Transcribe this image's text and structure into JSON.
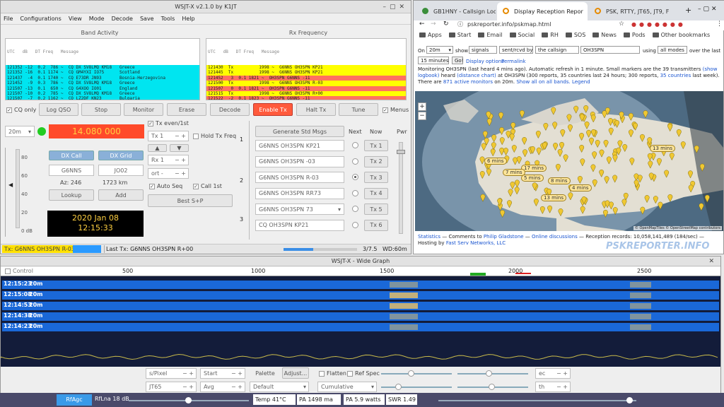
{
  "wsjt": {
    "title": "WSJT-X   v2.1.0   by K1JT",
    "menus": [
      "File",
      "Configurations",
      "View",
      "Mode",
      "Decode",
      "Save",
      "Tools",
      "Help"
    ],
    "band_activity_title": "Band Activity",
    "rx_freq_title": "Rx Frequency",
    "col_headers": "UTC   dB   DT Freq   Message",
    "band_rows": [
      "121352 -12  0.2  786 ~  CQ DX SV8LMQ KM18   Greece",
      "121352 -16  0.1 1174 ~  CQ GM4YXI IO75      Scotland",
      "121437  -4  0.1 1740 ~  CQ E73DR JN93       Bosnia-Herzegovina",
      "121452  -9  0.3  786 ~  CQ DX SV8LMQ KM18   Greece",
      "121507 -13  0.1  650 ~  CQ G4XOO IO01       England",
      "121507 -10  0.2  785 ~  CQ DX SV8LMQ KM18   Greece",
      "121507  -7  0.2 1162 ~  CQ LZ2DF KN23       Bulgaria",
      "121522  -2  0.2 1162 ~  CQ LZ2DF KN23       Bulgaria"
    ],
    "rx_rows": [
      {
        "t": "121430  Tx          1998 ~  G6NNS OH3SPN KP21",
        "c": "ye"
      },
      {
        "t": "121445  Tx          1998 ~  G6NNS OH3SPN KP21",
        "c": "ye"
      },
      {
        "t": "121452   3  0.1 1821 ~  OH3SPN G6NNS -11",
        "c": "rd"
      },
      {
        "t": "121500  Tx          1998 ~  G6NNS OH3SPN R-03",
        "c": "ye"
      },
      {
        "t": "121507   0  0.1 1821 ~  OH3SPN G6NNS -11",
        "c": "rd"
      },
      {
        "t": "121515  Tx          1998 ~  G6NNS OH3SPN R+00",
        "c": "ye"
      },
      {
        "t": "121522  -2  0.1 1823 ~  OH3SPN G6NNS -11",
        "c": "rd"
      },
      {
        "t": "121530  Tx          1998 ~  G6NNS OH3SPN R+03",
        "c": "ye"
      }
    ],
    "cq_only": "CQ only",
    "buttons": {
      "log_qso": "Log QSO",
      "stop": "Stop",
      "monitor": "Monitor",
      "erase": "Erase",
      "decode": "Decode",
      "enable_tx": "Enable Tx",
      "halt_tx": "Halt Tx",
      "tune": "Tune",
      "menus": "Menus"
    },
    "band": "20m",
    "frequency": "14.080 000",
    "tx_even": "Tx even/1st",
    "hold_tx": "Hold Tx Freq",
    "tx_field": "Tx 1",
    "rx_field": "Rx 1",
    "report_field": "ort -",
    "auto_seq": "Auto Seq",
    "call_1st": "Call 1st",
    "best_sp": "Best S+P",
    "dx_call_label": "DX Call",
    "dx_grid_label": "DX Grid",
    "dx_call": "G6NNS",
    "dx_grid": "JO02",
    "az": "Az: 246",
    "dist": "1723 km",
    "lookup": "Lookup",
    "add": "Add",
    "date": "2020 Jan 08",
    "time": "12:15:33",
    "db_ticks": [
      "80",
      "60",
      "40",
      "20",
      "0 dB"
    ],
    "gen_msgs": "Generate Std Msgs",
    "next": "Next",
    "now": "Now",
    "pwr": "Pwr",
    "tabs": [
      "1",
      "2",
      "3"
    ],
    "msgs": [
      "G6NNS OH3SPN KP21",
      "G6NNS OH3SPN -03",
      "G6NNS OH3SPN R-03",
      "G6NNS OH3SPN RR73",
      "G6NNS OH3SPN 73",
      "CQ OH3SPN KP21"
    ],
    "tx_btns": [
      "Tx 1",
      "Tx 2",
      "Tx 3",
      "Tx 4",
      "Tx 5",
      "Tx 6"
    ],
    "status_tx": "Tx: G6NNS OH3SPN R-03",
    "status_last": "Last Tx: G6NNS OH3SPN R+00",
    "status_prog": "3/7.5",
    "status_wd": "WD:60m"
  },
  "browser": {
    "tabs": [
      "GB1HNY - Callsign Look",
      "Display Reception Repor",
      "PSK, RTTY, JT65, JT9, F"
    ],
    "url": "pskreporter.info/pskmap.html",
    "bookmarks": [
      "Apps",
      "Start",
      "Email",
      "Social",
      "RH",
      "SOS",
      "News",
      "Pods",
      "Other bookmarks"
    ],
    "on": "On",
    "band": "20m",
    "show": "show",
    "signals": "signals",
    "sent": "sent/rcvd by",
    "callsign_sel": "the callsign",
    "callsign": "OH3SPN",
    "using": "using",
    "modes": "all modes",
    "over": "over the last",
    "period": "15 minutes",
    "go": "Go!",
    "display_opts": "Display options",
    "permalink": "Permalink",
    "monitoring": "Monitoring OH3SPN (last heard 4 mins ago). Automatic refresh in 1 minute. Small markers are the 39 transmitters",
    "show_logbook": "(show logbook)",
    "heard": "heard",
    "distance_chart": "(distance chart)",
    "at_line": "at OH3SPN (300 reports, 35 countries last 24 hours; 300 reports,",
    "countries_link": "35 countries",
    "last_week": "last week).",
    "there_are": "There are",
    "active": "871 active monitors",
    "on20": "on 20m.",
    "show_all": "Show all on all bands.",
    "legend": "Legend",
    "map_labels": [
      "6 mins",
      "13 mins",
      "17 mins",
      "5 mins",
      "13 mins",
      "4 mins",
      "8 mins",
      "7 mins"
    ],
    "map_credit": "© OpenMapTiles © OpenStreetMap contributors",
    "footer_stats": "Statistics",
    "footer_comments": "— Comments to",
    "footer_name": "Philip Gladstone",
    "footer_online": "Online discussions",
    "footer_records": "— Reception records: 10,058,141,489 (184/sec) — Hosting by",
    "footer_host": "Fast Serv Networks, LLC",
    "brand": "PSKREPORTER.INFO"
  },
  "wide": {
    "title": "WSJT-X - Wide Graph",
    "control": "Control",
    "scale": [
      "500",
      "1000",
      "1500",
      "2000",
      "2500"
    ],
    "rows": [
      {
        "time": "12:15:23",
        "band": "20m"
      },
      {
        "time": "12:15:08",
        "band": "20m"
      },
      {
        "time": "12:14:53",
        "band": "20m"
      },
      {
        "time": "12:14:38",
        "band": "20m"
      },
      {
        "time": "12:14:23",
        "band": "20m"
      }
    ],
    "bins": "s/Pixel",
    "start": "Start",
    "avg": "Avg",
    "jt65": "JT65",
    "palette": "Palette",
    "adjust": "Adjust...",
    "default": "Default",
    "flatten": "Flatten",
    "ref_spec": "Ref Spec",
    "cumulative": "Cumulative",
    "spec_field": "ec",
    "th_field": "th"
  },
  "taskbar": {
    "rfagc": "RfAgc",
    "rflna": "RfLna 18 dB",
    "temp": "Temp 41°C",
    "pa_ma": "PA 1498 ma",
    "pa_w": "PA 5.9 watts",
    "swr": "SWR 1.49"
  }
}
